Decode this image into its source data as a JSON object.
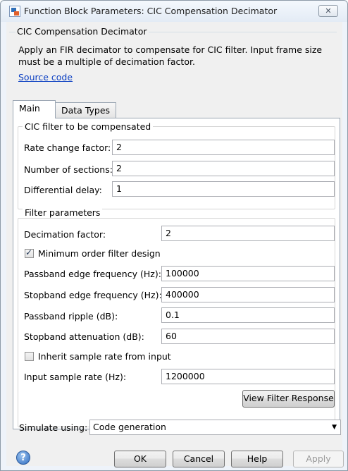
{
  "window": {
    "title": "Function Block Parameters: CIC Compensation Decimator",
    "close_glyph": "✕"
  },
  "block": {
    "name": "CIC Compensation Decimator",
    "description": "Apply an FIR decimator to compensate for CIC filter. Input frame size must be a multiple of decimation factor.",
    "source_link": "Source code"
  },
  "tabs": [
    {
      "label": "Main",
      "active": true
    },
    {
      "label": "Data Types",
      "active": false
    }
  ],
  "cic_group": {
    "title": "CIC filter to be compensated",
    "rate_change_factor": {
      "label": "Rate change factor:",
      "value": "2"
    },
    "number_of_sections": {
      "label": "Number of sections:",
      "value": "2"
    },
    "differential_delay": {
      "label": "Differential delay:",
      "value": "1"
    }
  },
  "filter_group": {
    "title": "Filter parameters",
    "decimation_factor": {
      "label": "Decimation factor:",
      "value": "2"
    },
    "min_order": {
      "label": "Minimum order filter design",
      "checked": true
    },
    "passband_edge": {
      "label": "Passband edge frequency (Hz):",
      "value": "100000"
    },
    "stopband_edge": {
      "label": "Stopband edge frequency (Hz):",
      "value": "400000"
    },
    "passband_ripple": {
      "label": "Passband ripple (dB):",
      "value": "0.1"
    },
    "stopband_atten": {
      "label": "Stopband attenuation (dB):",
      "value": "60"
    },
    "inherit_rate": {
      "label": "Inherit sample rate from input",
      "checked": false
    },
    "input_rate": {
      "label": "Input sample rate (Hz):",
      "value": "1200000"
    },
    "view_button": "View Filter Response"
  },
  "simulate": {
    "label": "Simulate using:",
    "value": "Code generation"
  },
  "footer": {
    "help_icon": "help-icon",
    "ok": "OK",
    "cancel": "Cancel",
    "help": "Help",
    "apply": "Apply"
  }
}
